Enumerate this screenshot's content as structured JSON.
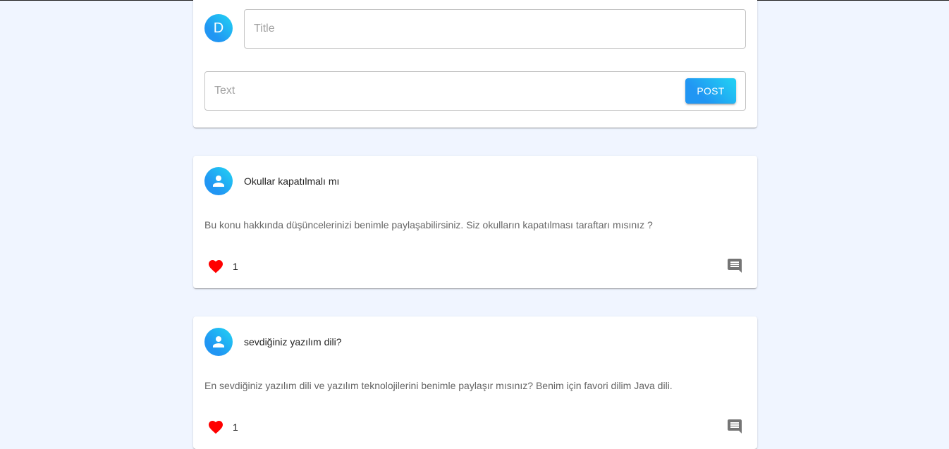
{
  "compose": {
    "avatar_letter": "D",
    "title_placeholder": "Title",
    "text_placeholder": "Text",
    "post_label": "POST"
  },
  "posts": [
    {
      "title": "Okullar kapatılmalı mı",
      "text": "Bu konu hakkında düşüncelerinizi benimle paylaşabilirsiniz. Siz okulların kapatılması taraftarı mısınız ?",
      "likes": "1"
    },
    {
      "title": "sevdiğiniz yazılım dili?",
      "text": "En sevdiğiniz yazılım dili ve yazılım teknolojilerini benimle paylaşır mısınız? Benim için favori dilim Java dili.",
      "likes": "1"
    }
  ],
  "colors": {
    "background": "#f0f5ff",
    "accent_start": "#2196f3",
    "accent_end": "#21cbf3",
    "like": "#ff0000",
    "icon_gray": "#757575"
  },
  "icons": {
    "like": "heart-icon",
    "comment": "comment-icon",
    "user": "person-icon"
  }
}
